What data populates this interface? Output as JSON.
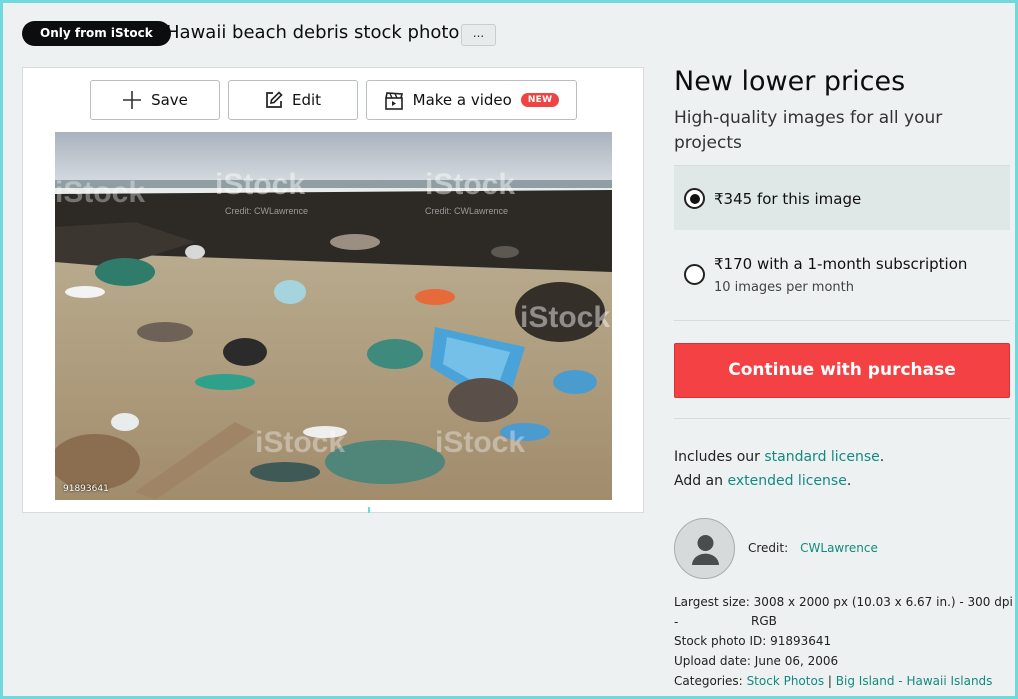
{
  "header": {
    "badge": "Only from iStock",
    "title": "Hawaii beach debris stock photo",
    "more_label": "..."
  },
  "toolbar": {
    "save_label": "Save",
    "edit_label": "Edit",
    "video_label": "Make a video",
    "new_badge": "NEW"
  },
  "photo": {
    "watermark": "iStock",
    "watermark_sub": "Credit: CWLawrence",
    "id_text": "91893641"
  },
  "pricing": {
    "headline": "New lower prices",
    "subhead": "High-quality images for all your projects",
    "option1_label": "₹345 for this image",
    "option2_label": "₹170 with a 1-month subscription",
    "option2_sub": "10 images per month",
    "cta_label": "Continue with purchase"
  },
  "license": {
    "line1_prefix": "Includes our ",
    "line1_link": "standard license",
    "line1_suffix": ".",
    "line2_prefix": "Add an ",
    "line2_link": "extended license",
    "line2_suffix": "."
  },
  "credit": {
    "label": "Credit:",
    "name": "CWLawrence"
  },
  "details": {
    "largest_label": "Largest size:",
    "largest_value1": "3008 x 2000 px (10.03 x 6.67 in.) - 300 dpi -",
    "largest_value2": "RGB",
    "id_label": "Stock photo ID:",
    "id_value": "91893641",
    "upload_label": "Upload date:",
    "upload_value": "June 06, 2006",
    "categories_label": "Categories:",
    "category1": "Stock Photos",
    "separator": "|",
    "category2": "Big Island - Hawaii Islands"
  },
  "colors": {
    "accent": "#138a80",
    "cta": "#f44244",
    "badge_bg": "#0c0d0e",
    "frame": "#6fd9dc"
  },
  "icons": {
    "save": "plus-icon",
    "edit": "pencil-square-icon",
    "video": "clapperboard-icon",
    "avatar": "person-icon"
  }
}
